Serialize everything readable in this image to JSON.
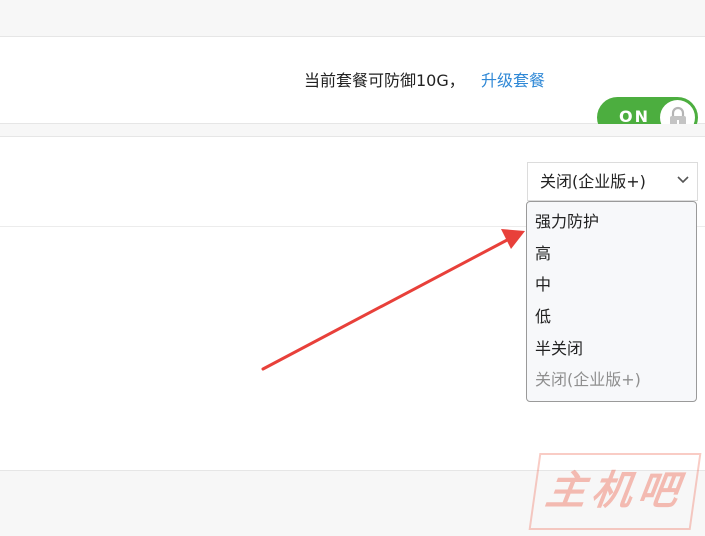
{
  "plan_panel": {
    "plan_text": "当前套餐可防御10G，",
    "upgrade_link": "升级套餐",
    "toggle": {
      "state_label": "ON",
      "locked": true,
      "on": true,
      "icon": "lock-icon",
      "color": "#4cae3f"
    }
  },
  "level_panel": {
    "select": {
      "value": "关闭(企业版+)",
      "icon": "chevron-down-icon"
    },
    "dropdown": {
      "options": [
        {
          "label": "强力防护",
          "disabled": false
        },
        {
          "label": "高",
          "disabled": false
        },
        {
          "label": "中",
          "disabled": false
        },
        {
          "label": "低",
          "disabled": false
        },
        {
          "label": "半关闭",
          "disabled": false
        },
        {
          "label": "关闭(企业版+)",
          "disabled": true
        }
      ]
    }
  },
  "annotation": {
    "arrow_color": "#e8403a"
  },
  "watermark": {
    "text": "主机吧"
  },
  "colors": {
    "link": "#2f88d6",
    "toggle_on": "#4cae3f",
    "page_bg": "#f7f7f7"
  }
}
